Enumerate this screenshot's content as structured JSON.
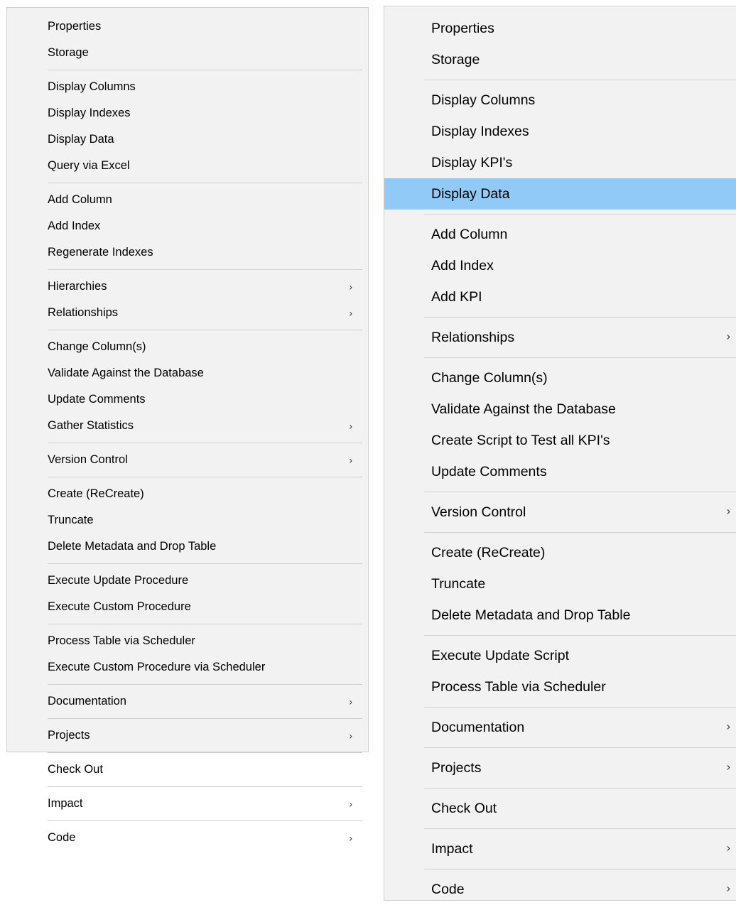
{
  "left_menu": {
    "groups": [
      [
        {
          "label": "Properties"
        },
        {
          "label": "Storage"
        }
      ],
      [
        {
          "label": "Display Columns"
        },
        {
          "label": "Display Indexes"
        },
        {
          "label": "Display Data"
        },
        {
          "label": "Query via Excel"
        }
      ],
      [
        {
          "label": "Add Column"
        },
        {
          "label": "Add Index"
        },
        {
          "label": "Regenerate Indexes"
        }
      ],
      [
        {
          "label": "Hierarchies",
          "submenu": true
        },
        {
          "label": "Relationships",
          "submenu": true
        }
      ],
      [
        {
          "label": "Change Column(s)"
        },
        {
          "label": "Validate Against the Database"
        },
        {
          "label": "Update Comments"
        },
        {
          "label": "Gather Statistics",
          "submenu": true
        }
      ],
      [
        {
          "label": "Version Control",
          "submenu": true
        }
      ],
      [
        {
          "label": "Create (ReCreate)"
        },
        {
          "label": "Truncate"
        },
        {
          "label": "Delete Metadata and Drop Table"
        }
      ],
      [
        {
          "label": "Execute Update Procedure"
        },
        {
          "label": "Execute Custom Procedure"
        }
      ],
      [
        {
          "label": "Process Table via Scheduler"
        },
        {
          "label": "Execute Custom Procedure via Scheduler"
        }
      ],
      [
        {
          "label": "Documentation",
          "submenu": true
        }
      ],
      [
        {
          "label": "Projects",
          "submenu": true
        }
      ],
      [
        {
          "label": "Check Out"
        }
      ],
      [
        {
          "label": "Impact",
          "submenu": true
        }
      ],
      [
        {
          "label": "Code",
          "submenu": true
        }
      ]
    ]
  },
  "right_menu": {
    "groups": [
      [
        {
          "label": "Properties"
        },
        {
          "label": "Storage"
        }
      ],
      [
        {
          "label": "Display Columns"
        },
        {
          "label": "Display Indexes"
        },
        {
          "label": "Display KPI's"
        },
        {
          "label": "Display Data",
          "highlighted": true
        }
      ],
      [
        {
          "label": "Add Column"
        },
        {
          "label": "Add Index"
        },
        {
          "label": "Add KPI"
        }
      ],
      [
        {
          "label": "Relationships",
          "submenu": true
        }
      ],
      [
        {
          "label": "Change Column(s)"
        },
        {
          "label": "Validate Against the Database"
        },
        {
          "label": "Create Script to Test all KPI's"
        },
        {
          "label": "Update Comments"
        }
      ],
      [
        {
          "label": "Version Control",
          "submenu": true
        }
      ],
      [
        {
          "label": "Create (ReCreate)"
        },
        {
          "label": "Truncate"
        },
        {
          "label": "Delete Metadata and Drop Table"
        }
      ],
      [
        {
          "label": "Execute Update Script"
        },
        {
          "label": "Process Table via Scheduler"
        }
      ],
      [
        {
          "label": "Documentation",
          "submenu": true
        }
      ],
      [
        {
          "label": "Projects",
          "submenu": true
        }
      ],
      [
        {
          "label": "Check Out"
        }
      ],
      [
        {
          "label": "Impact",
          "submenu": true
        }
      ],
      [
        {
          "label": "Code",
          "submenu": true
        }
      ]
    ]
  },
  "submenu_arrow_glyph": "›",
  "highlight_color": "#91c9f7",
  "menu_background": "#f2f2f2",
  "icons": {
    "submenu": "chevron-right-icon"
  }
}
